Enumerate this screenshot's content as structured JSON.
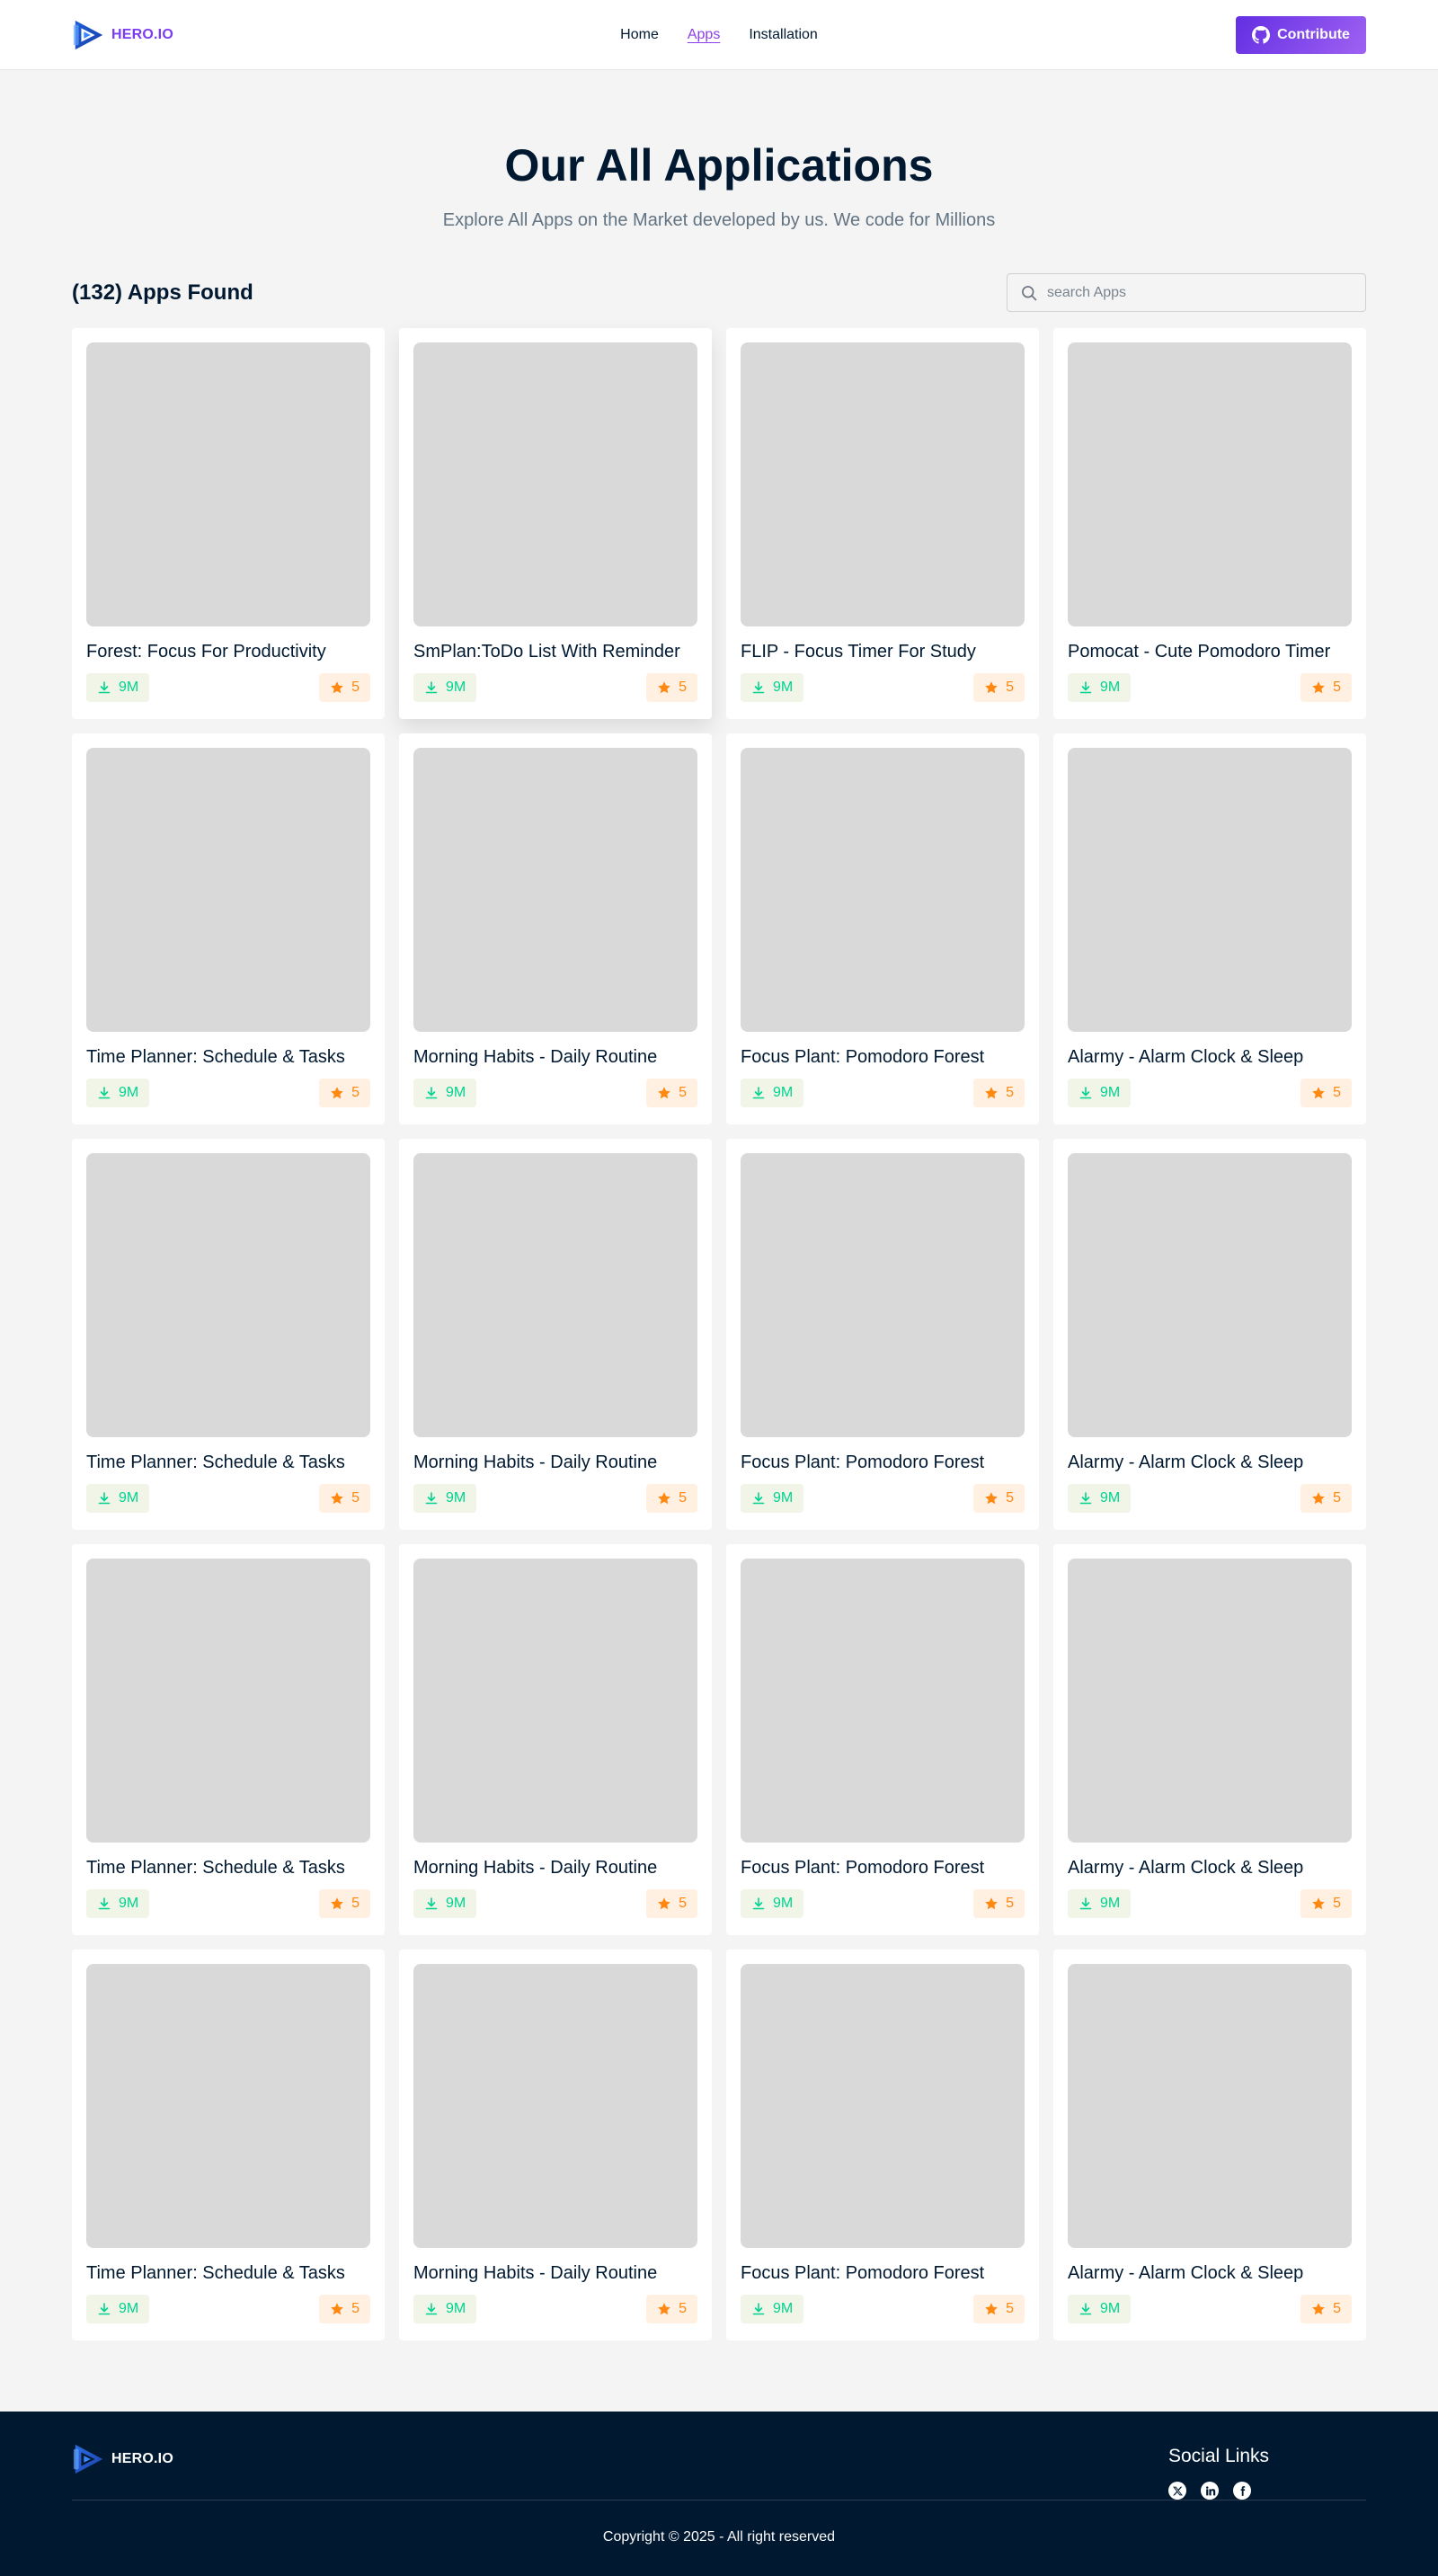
{
  "header": {
    "brand": "HERO.IO",
    "nav": [
      {
        "label": "Home",
        "active": false
      },
      {
        "label": "Apps",
        "active": true
      },
      {
        "label": "Installation",
        "active": false
      }
    ],
    "contribute_label": "Contribute",
    "accent": "#8b3fe8"
  },
  "hero": {
    "title": "Our All Applications",
    "subtitle": "Explore All Apps on the Market developed by us. We code for Millions"
  },
  "toolbar": {
    "count_label": "(132) Apps Found",
    "search_placeholder": "search Apps"
  },
  "apps": [
    {
      "title": "Forest: Focus For Productivity",
      "downloads": "9M",
      "rating": "5"
    },
    {
      "title": "SmPlan:ToDo List With Reminder",
      "downloads": "9M",
      "rating": "5"
    },
    {
      "title": "FLIP - Focus Timer For Study",
      "downloads": "9M",
      "rating": "5"
    },
    {
      "title": "Pomocat - Cute Pomodoro Timer",
      "downloads": "9M",
      "rating": "5"
    },
    {
      "title": "Time Planner: Schedule & Tasks",
      "downloads": "9M",
      "rating": "5"
    },
    {
      "title": "Morning Habits - Daily Routine",
      "downloads": "9M",
      "rating": "5"
    },
    {
      "title": "Focus Plant: Pomodoro Forest",
      "downloads": "9M",
      "rating": "5"
    },
    {
      "title": "Alarmy - Alarm Clock & Sleep",
      "downloads": "9M",
      "rating": "5"
    },
    {
      "title": "Time Planner: Schedule & Tasks",
      "downloads": "9M",
      "rating": "5"
    },
    {
      "title": "Morning Habits - Daily Routine",
      "downloads": "9M",
      "rating": "5"
    },
    {
      "title": "Focus Plant: Pomodoro Forest",
      "downloads": "9M",
      "rating": "5"
    },
    {
      "title": "Alarmy - Alarm Clock & Sleep",
      "downloads": "9M",
      "rating": "5"
    },
    {
      "title": "Time Planner: Schedule & Tasks",
      "downloads": "9M",
      "rating": "5"
    },
    {
      "title": "Morning Habits - Daily Routine",
      "downloads": "9M",
      "rating": "5"
    },
    {
      "title": "Focus Plant: Pomodoro Forest",
      "downloads": "9M",
      "rating": "5"
    },
    {
      "title": "Alarmy - Alarm Clock & Sleep",
      "downloads": "9M",
      "rating": "5"
    },
    {
      "title": "Time Planner: Schedule & Tasks",
      "downloads": "9M",
      "rating": "5"
    },
    {
      "title": "Morning Habits - Daily Routine",
      "downloads": "9M",
      "rating": "5"
    },
    {
      "title": "Focus Plant: Pomodoro Forest",
      "downloads": "9M",
      "rating": "5"
    },
    {
      "title": "Alarmy - Alarm Clock & Sleep",
      "downloads": "9M",
      "rating": "5"
    }
  ],
  "footer": {
    "brand": "HERO.IO",
    "social_title": "Social Links",
    "social_icons": [
      "x-icon",
      "linkedin-icon",
      "facebook-icon"
    ],
    "copyright": "Copyright © 2025 - All right reserved"
  },
  "colors": {
    "download_green": "#00d390",
    "rating_orange": "#ff8811",
    "footer_bg": "#001931"
  }
}
